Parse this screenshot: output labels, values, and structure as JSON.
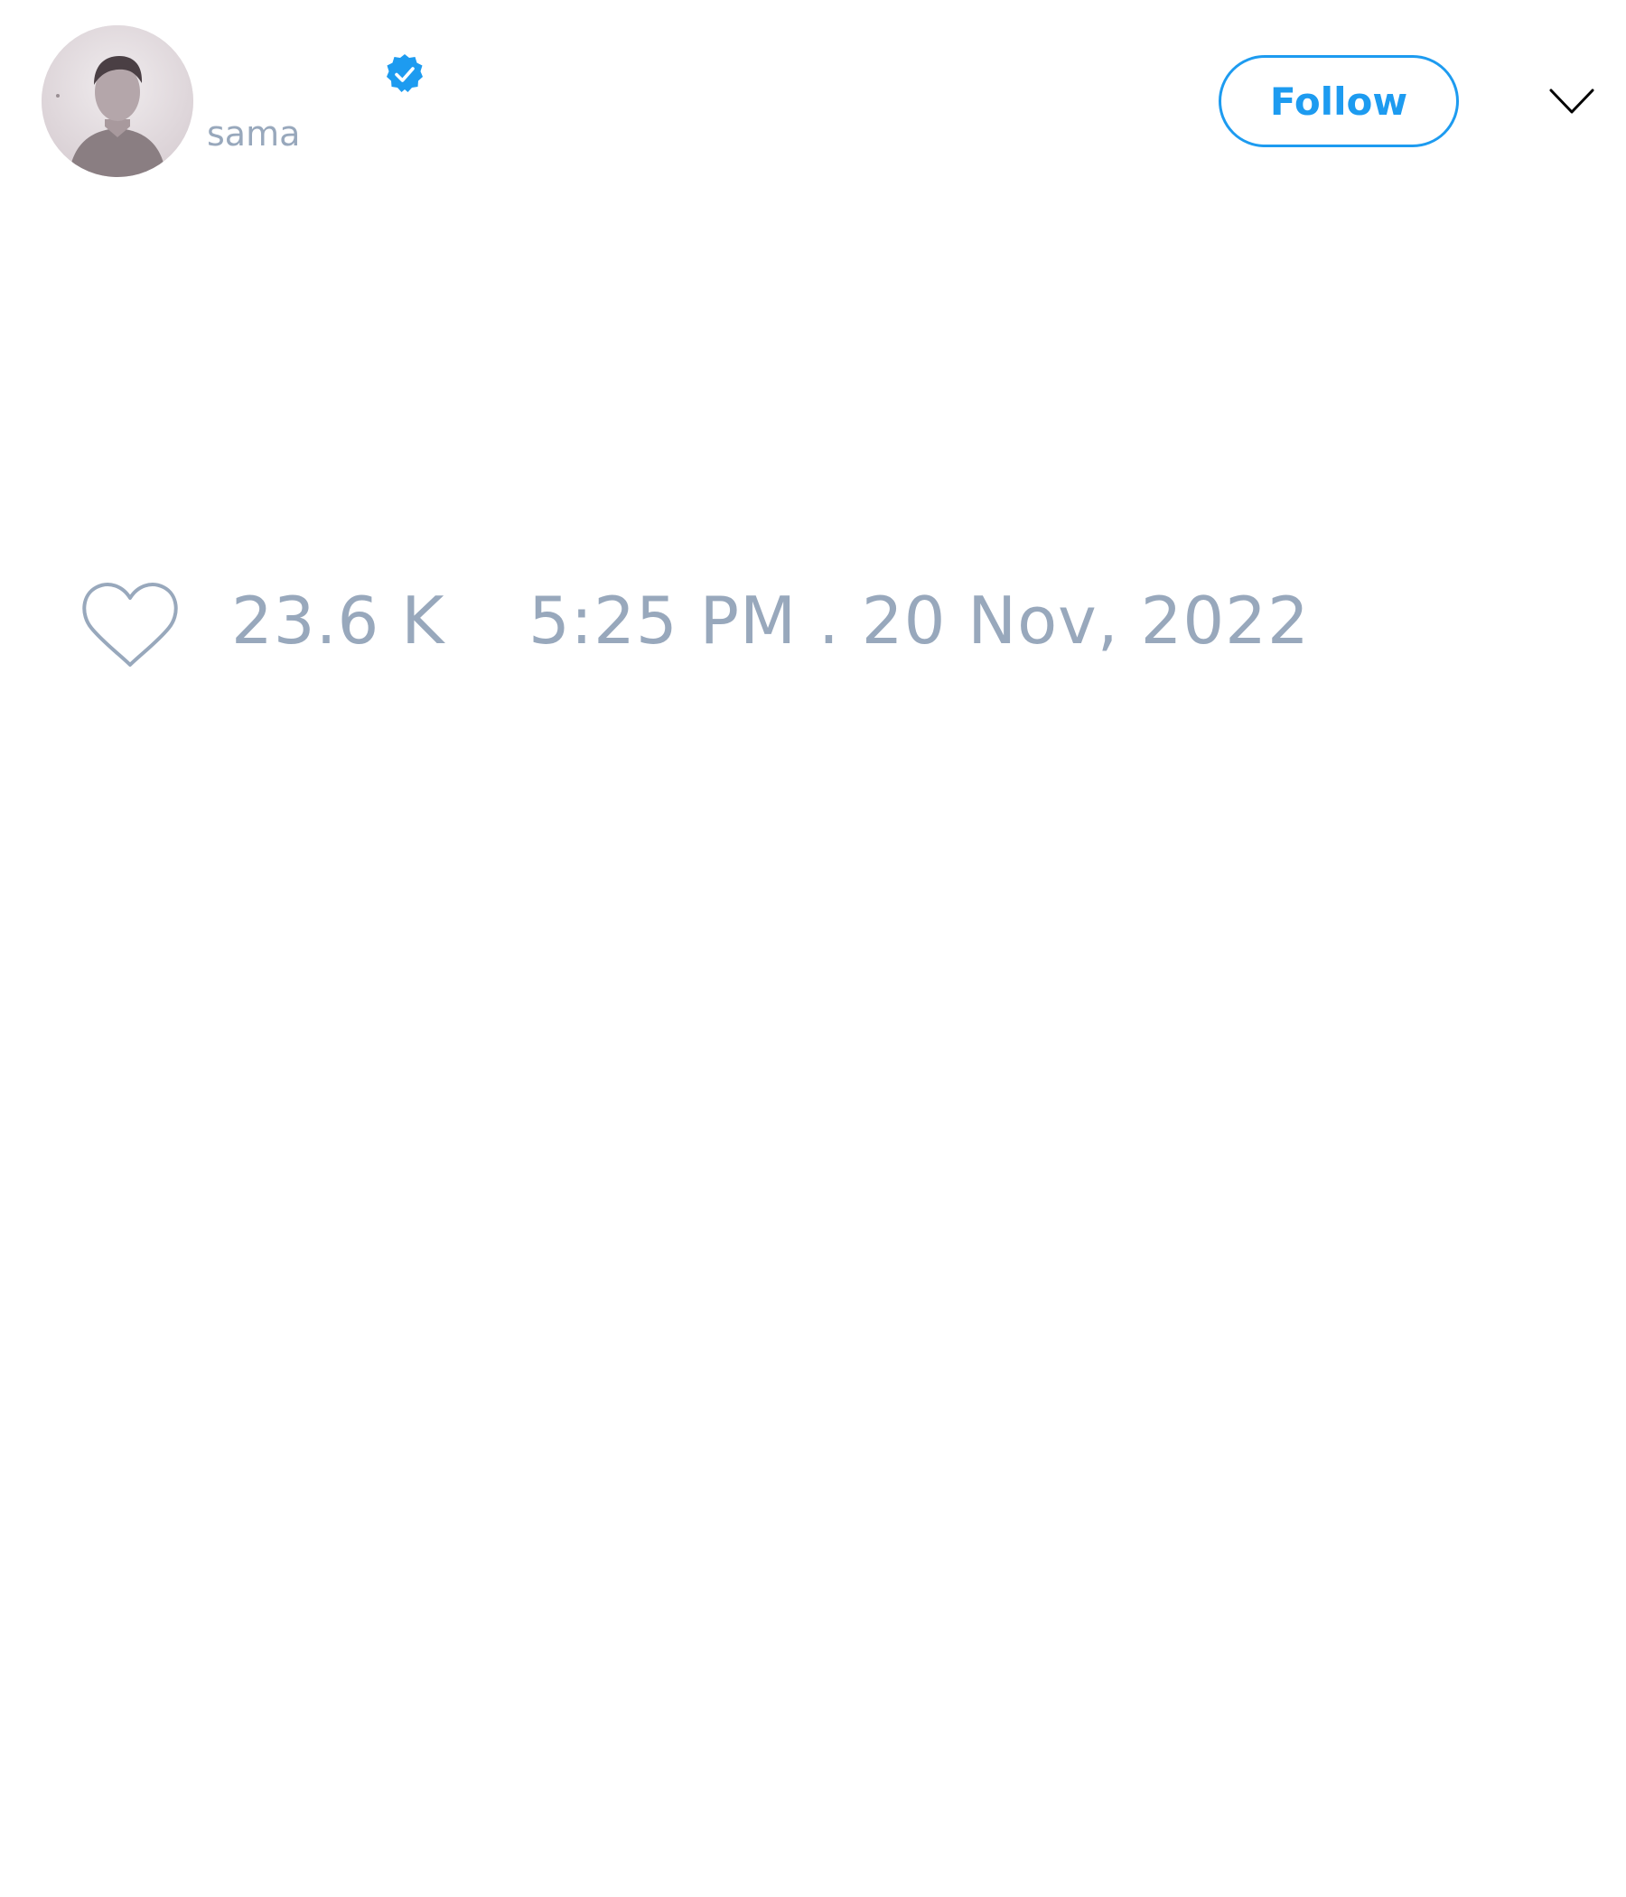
{
  "author": {
    "handle": "sama",
    "verified": true,
    "avatar_icon": "profile-photo"
  },
  "header": {
    "follow_label": "Follow",
    "menu_icon": "chevron-down-icon"
  },
  "engagement": {
    "like_icon": "heart-outline-icon",
    "like_count": "23.6 K",
    "timestamp": "5:25 PM . 20 Nov, 2022"
  },
  "colors": {
    "accent": "#1d9bf0",
    "muted_text": "#98a8bc",
    "background": "#ffffff"
  }
}
